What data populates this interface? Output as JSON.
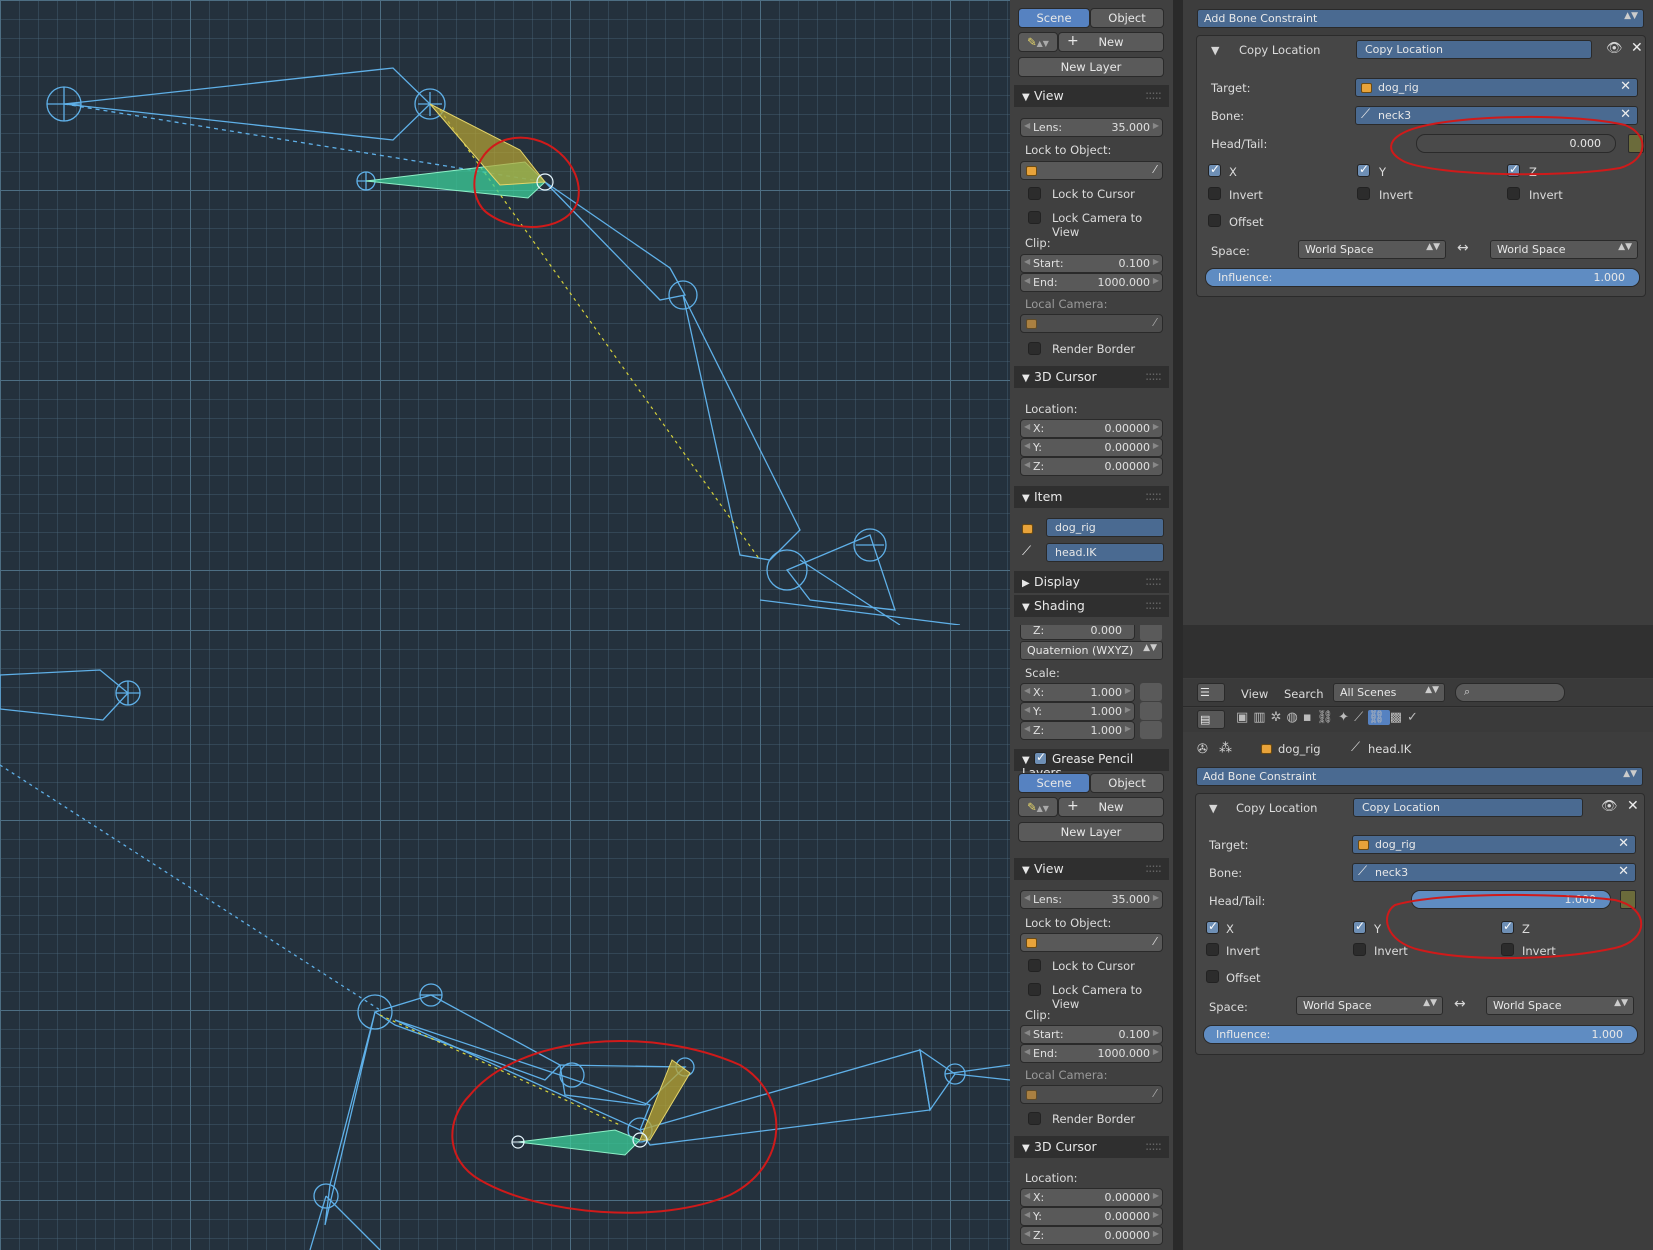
{
  "colors": {
    "viewport_bg": "#24313d",
    "bone": "#5fb0e8",
    "selected_bone": "#3ccf9a",
    "selected_tip": "#b9a533",
    "annotation": "#d01a1a",
    "accent": "#5682c1"
  },
  "top": {
    "npanel": {
      "tabs": [
        "Scene",
        "Object"
      ],
      "new": "New",
      "new_layer": "New Layer",
      "view": {
        "title": "View",
        "lens_label": "Lens:",
        "lens_value": "35.000",
        "lock_obj": "Lock to Object:",
        "lock_cursor": "Lock to Cursor",
        "lock_cam": "Lock Camera to View",
        "clip": "Clip:",
        "start_label": "Start:",
        "start_value": "0.100",
        "end_label": "End:",
        "end_value": "1000.000",
        "local_cam": "Local Camera:",
        "render_border": "Render Border"
      },
      "cursor": {
        "title": "3D Cursor",
        "location": "Location:",
        "x_label": "X:",
        "x": "0.00000",
        "y_label": "Y:",
        "y": "0.00000",
        "z_label": "Z:",
        "z": "0.00000"
      },
      "item": {
        "title": "Item",
        "object": "dog_rig",
        "bone": "head.IK"
      },
      "display": "Display",
      "shading": "Shading"
    },
    "constraint": {
      "add": "Add Bone Constraint",
      "name": "Copy Location",
      "name_field": "Copy Location",
      "target_label": "Target:",
      "target": "dog_rig",
      "bone_label": "Bone:",
      "bone": "neck3",
      "headtail_label": "Head/Tail:",
      "headtail": "0.000",
      "headtail_fraction": 0.0,
      "x": "X",
      "y": "Y",
      "z": "Z",
      "invert": "Invert",
      "offset": "Offset",
      "space_label": "Space:",
      "space_a": "World Space",
      "space_b": "World Space",
      "influence_label": "Influence:",
      "influence": "1.000",
      "influence_fraction": 1.0
    }
  },
  "bottom": {
    "npanel": {
      "z_partial": "Z:",
      "z_partial_value": "0.000",
      "rotation_mode": "Quaternion (WXYZ)",
      "scale": "Scale:",
      "scale_x_label": "X:",
      "scale_x": "1.000",
      "scale_y_label": "Y:",
      "scale_y": "1.000",
      "scale_z_label": "Z:",
      "scale_z": "1.000",
      "gp_layers": "Grease Pencil Layers",
      "tabs": [
        "Scene",
        "Object"
      ],
      "new": "New",
      "new_layer": "New Layer",
      "view": {
        "title": "View",
        "lens_label": "Lens:",
        "lens_value": "35.000",
        "lock_obj": "Lock to Object:",
        "lock_cursor": "Lock to Cursor",
        "lock_cam": "Lock Camera to View",
        "clip": "Clip:",
        "start_label": "Start:",
        "start_value": "0.100",
        "end_label": "End:",
        "end_value": "1000.000",
        "local_cam": "Local Camera:",
        "render_border": "Render Border"
      },
      "cursor": {
        "title": "3D Cursor",
        "location": "Location:",
        "x_label": "X:",
        "x": "0.00000",
        "y_label": "Y:",
        "y": "0.00000",
        "z_label": "Z:",
        "z": "0.00000"
      }
    },
    "outliner": {
      "view": "View",
      "search": "Search",
      "scenes": "All Scenes"
    },
    "breadcrumb": {
      "object": "dog_rig",
      "bone": "head.IK"
    },
    "constraint": {
      "add": "Add Bone Constraint",
      "name": "Copy Location",
      "name_field": "Copy Location",
      "target_label": "Target:",
      "target": "dog_rig",
      "bone_label": "Bone:",
      "bone": "neck3",
      "headtail_label": "Head/Tail:",
      "headtail": "1.000",
      "headtail_fraction": 1.0,
      "x": "X",
      "y": "Y",
      "z": "Z",
      "invert": "Invert",
      "offset": "Offset",
      "space_label": "Space:",
      "space_a": "World Space",
      "space_b": "World Space",
      "influence_label": "Influence:",
      "influence": "1.000",
      "influence_fraction": 1.0
    }
  }
}
